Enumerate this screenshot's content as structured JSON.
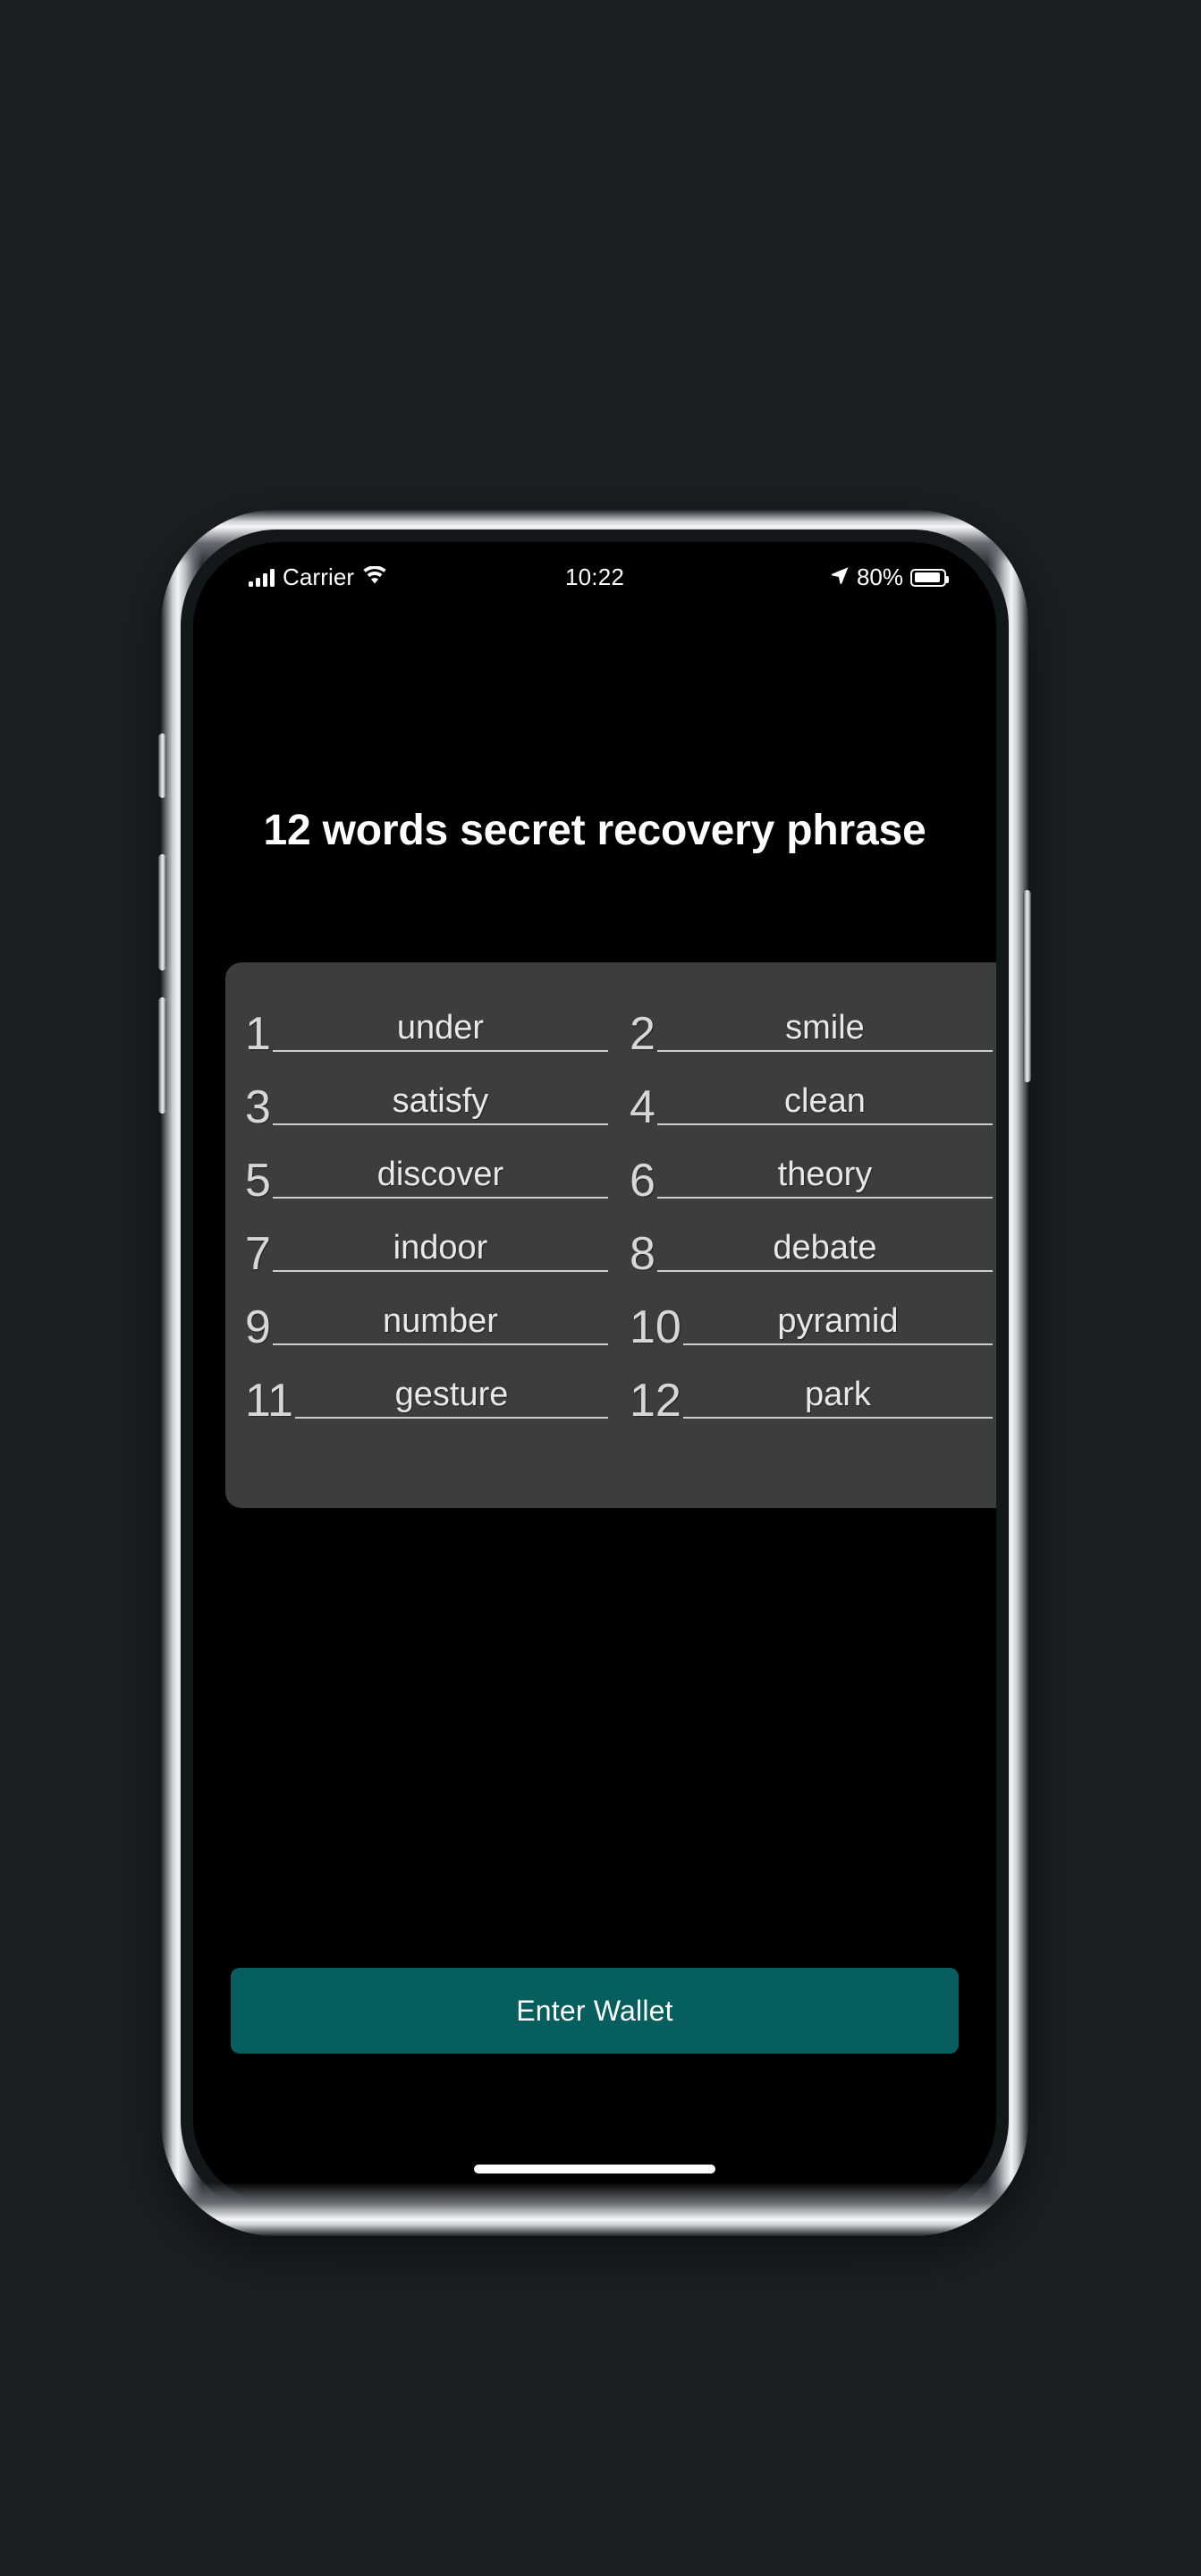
{
  "theme": {
    "page_background": "#1b2023",
    "screen_background": "#000000",
    "card_background": "#3d3d3d",
    "accent": "#075e5e",
    "word_text_color": "#e8e8e8",
    "index_text_color": "#d7d7d7"
  },
  "status_bar": {
    "signal_icon": "signal-bars-icon",
    "carrier": "Carrier",
    "wifi_icon": "wifi-icon",
    "time": "10:22",
    "location_icon": "location-arrow-icon",
    "battery_percent": "80%",
    "battery_level": 80,
    "battery_icon": "battery-icon"
  },
  "screen": {
    "title": "12 words secret recovery phrase"
  },
  "recovery_phrase": {
    "word_count": 12,
    "words": [
      {
        "index": "1",
        "word": "under"
      },
      {
        "index": "2",
        "word": "smile"
      },
      {
        "index": "3",
        "word": "satisfy"
      },
      {
        "index": "4",
        "word": "clean"
      },
      {
        "index": "5",
        "word": "discover"
      },
      {
        "index": "6",
        "word": "theory"
      },
      {
        "index": "7",
        "word": "indoor"
      },
      {
        "index": "8",
        "word": "debate"
      },
      {
        "index": "9",
        "word": "number"
      },
      {
        "index": "10",
        "word": "pyramid"
      },
      {
        "index": "11",
        "word": "gesture"
      },
      {
        "index": "12",
        "word": "park"
      }
    ]
  },
  "actions": {
    "primary_button": "Enter Wallet"
  },
  "device_controls": {
    "silent_switch": "silent-switch",
    "volume_up": "volume-up-button",
    "volume_down": "volume-down-button",
    "power": "power-button",
    "home_indicator": "home-indicator"
  }
}
